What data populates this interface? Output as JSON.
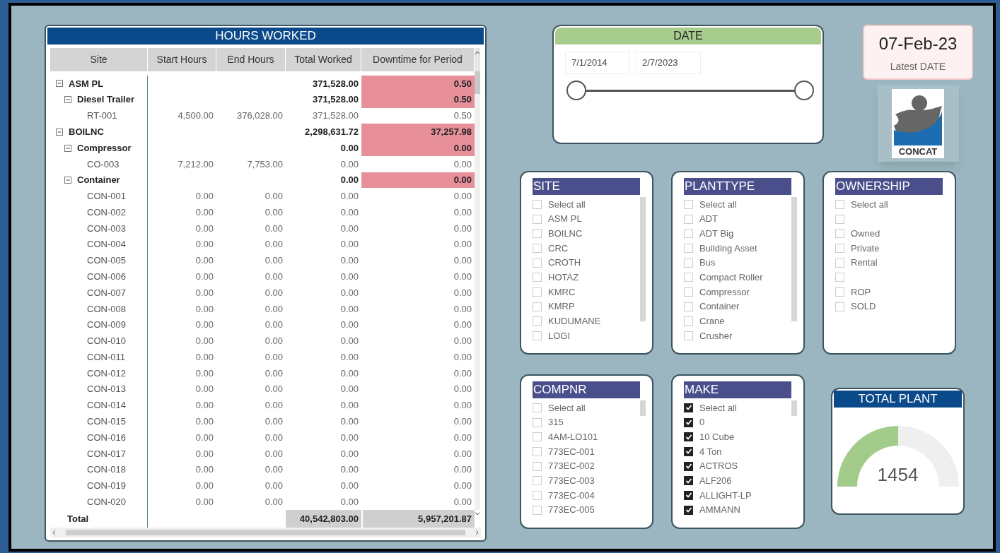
{
  "hours_worked": {
    "title": "HOURS WORKED",
    "columns": [
      "Site",
      "Start Hours",
      "End Hours",
      "Total Worked",
      "Downtime for Period"
    ],
    "rows": [
      {
        "site": "ASM PL",
        "expanded": true,
        "total_worked": "371,528.00",
        "downtime": "0.50",
        "children": [
          {
            "site": "Diesel Trailer",
            "expanded": true,
            "total_worked": "371,528.00",
            "downtime": "0.50",
            "children": [
              {
                "site": "RT-001",
                "start_hours": "4,500.00",
                "end_hours": "376,028.00",
                "total_worked": "371,528.00",
                "downtime": "0.50"
              }
            ]
          }
        ]
      },
      {
        "site": "BOILNC",
        "expanded": true,
        "total_worked": "2,298,631.72",
        "downtime": "37,257.98",
        "children": [
          {
            "site": "Compressor",
            "expanded": true,
            "total_worked": "0.00",
            "downtime": "0.00",
            "children": [
              {
                "site": "CO-003",
                "start_hours": "7,212.00",
                "end_hours": "7,753.00",
                "total_worked": "0.00",
                "downtime": "0.00"
              }
            ]
          },
          {
            "site": "Container",
            "expanded": true,
            "total_worked": "0.00",
            "downtime": "0.00",
            "children": [
              {
                "site": "CON-001",
                "start_hours": "0.00",
                "end_hours": "0.00",
                "total_worked": "0.00",
                "downtime": "0.00"
              },
              {
                "site": "CON-002",
                "start_hours": "0.00",
                "end_hours": "0.00",
                "total_worked": "0.00",
                "downtime": "0.00"
              },
              {
                "site": "CON-003",
                "start_hours": "0.00",
                "end_hours": "0.00",
                "total_worked": "0.00",
                "downtime": "0.00"
              },
              {
                "site": "CON-004",
                "start_hours": "0.00",
                "end_hours": "0.00",
                "total_worked": "0.00",
                "downtime": "0.00"
              },
              {
                "site": "CON-005",
                "start_hours": "0.00",
                "end_hours": "0.00",
                "total_worked": "0.00",
                "downtime": "0.00"
              },
              {
                "site": "CON-006",
                "start_hours": "0.00",
                "end_hours": "0.00",
                "total_worked": "0.00",
                "downtime": "0.00"
              },
              {
                "site": "CON-007",
                "start_hours": "0.00",
                "end_hours": "0.00",
                "total_worked": "0.00",
                "downtime": "0.00"
              },
              {
                "site": "CON-008",
                "start_hours": "0.00",
                "end_hours": "0.00",
                "total_worked": "0.00",
                "downtime": "0.00"
              },
              {
                "site": "CON-009",
                "start_hours": "0.00",
                "end_hours": "0.00",
                "total_worked": "0.00",
                "downtime": "0.00"
              },
              {
                "site": "CON-010",
                "start_hours": "0.00",
                "end_hours": "0.00",
                "total_worked": "0.00",
                "downtime": "0.00"
              },
              {
                "site": "CON-011",
                "start_hours": "0.00",
                "end_hours": "0.00",
                "total_worked": "0.00",
                "downtime": "0.00"
              },
              {
                "site": "CON-012",
                "start_hours": "0.00",
                "end_hours": "0.00",
                "total_worked": "0.00",
                "downtime": "0.00"
              },
              {
                "site": "CON-013",
                "start_hours": "0.00",
                "end_hours": "0.00",
                "total_worked": "0.00",
                "downtime": "0.00"
              },
              {
                "site": "CON-014",
                "start_hours": "0.00",
                "end_hours": "0.00",
                "total_worked": "0.00",
                "downtime": "0.00"
              },
              {
                "site": "CON-015",
                "start_hours": "0.00",
                "end_hours": "0.00",
                "total_worked": "0.00",
                "downtime": "0.00"
              },
              {
                "site": "CON-016",
                "start_hours": "0.00",
                "end_hours": "0.00",
                "total_worked": "0.00",
                "downtime": "0.00"
              },
              {
                "site": "CON-017",
                "start_hours": "0.00",
                "end_hours": "0.00",
                "total_worked": "0.00",
                "downtime": "0.00"
              },
              {
                "site": "CON-018",
                "start_hours": "0.00",
                "end_hours": "0.00",
                "total_worked": "0.00",
                "downtime": "0.00"
              },
              {
                "site": "CON-019",
                "start_hours": "0.00",
                "end_hours": "0.00",
                "total_worked": "0.00",
                "downtime": "0.00"
              },
              {
                "site": "CON-020",
                "start_hours": "0.00",
                "end_hours": "0.00",
                "total_worked": "0.00",
                "downtime": "0.00"
              }
            ]
          }
        ]
      }
    ],
    "total": {
      "label": "Total",
      "total_worked": "40,542,803.00",
      "downtime": "5,957,201.87"
    }
  },
  "date_slicer": {
    "title": "DATE",
    "start": "7/1/2014",
    "end": "2/7/2023"
  },
  "latest_date": {
    "value": "07-Feb-23",
    "label": "Latest DATE"
  },
  "logo": {
    "text": "CONCAT"
  },
  "slicers": [
    {
      "title": "SITE",
      "items": [
        {
          "label": "Select all",
          "checked": false
        },
        {
          "label": "ASM PL",
          "checked": false
        },
        {
          "label": "BOILNC",
          "checked": false
        },
        {
          "label": "CRC",
          "checked": false
        },
        {
          "label": "CROTH",
          "checked": false
        },
        {
          "label": "HOTAZ",
          "checked": false
        },
        {
          "label": "KMRC",
          "checked": false
        },
        {
          "label": "KMRP",
          "checked": false
        },
        {
          "label": "KUDUMANE",
          "checked": false
        },
        {
          "label": "LOGI",
          "checked": false
        }
      ]
    },
    {
      "title": "PLANTTYPE",
      "items": [
        {
          "label": "Select all",
          "checked": false
        },
        {
          "label": "ADT",
          "checked": false
        },
        {
          "label": "ADT Big",
          "checked": false
        },
        {
          "label": "Building Asset",
          "checked": false
        },
        {
          "label": "Bus",
          "checked": false
        },
        {
          "label": "Compact Roller",
          "checked": false
        },
        {
          "label": "Compressor",
          "checked": false
        },
        {
          "label": "Container",
          "checked": false
        },
        {
          "label": "Crane",
          "checked": false
        },
        {
          "label": "Crusher",
          "checked": false
        }
      ]
    },
    {
      "title": "OWNERSHIP",
      "items": [
        {
          "label": "Select all",
          "checked": false
        },
        {
          "checked": false
        },
        {
          "label": "Owned",
          "checked": false
        },
        {
          "label": "Private",
          "checked": false
        },
        {
          "label": "Rental",
          "checked": false
        },
        {
          "checked": false
        },
        {
          "label": "ROP",
          "checked": false
        },
        {
          "label": "SOLD",
          "checked": false
        }
      ]
    },
    {
      "title": "COMPNR",
      "items": [
        {
          "label": "Select all",
          "checked": false
        },
        {
          "label": "315",
          "checked": false
        },
        {
          "label": "4AM-LO101",
          "checked": false
        },
        {
          "label": "773EC-001",
          "checked": false
        },
        {
          "label": "773EC-002",
          "checked": false
        },
        {
          "label": "773EC-003",
          "checked": false
        },
        {
          "label": "773EC-004",
          "checked": false
        },
        {
          "label": "773EC-005",
          "checked": false
        }
      ]
    },
    {
      "title": "MAKE",
      "items": [
        {
          "label": "Select all",
          "checked": true
        },
        {
          "label": "0",
          "checked": true
        },
        {
          "label": "10 Cube",
          "checked": true
        },
        {
          "label": "4 Ton",
          "checked": true
        },
        {
          "label": "ACTROS",
          "checked": true
        },
        {
          "label": "ALF206",
          "checked": true
        },
        {
          "label": "ALLIGHT-LP",
          "checked": true
        },
        {
          "label": "AMMANN",
          "checked": true
        }
      ]
    }
  ],
  "total_plant": {
    "title": "TOTAL PLANT",
    "value": "1454",
    "level": 0.5
  }
}
